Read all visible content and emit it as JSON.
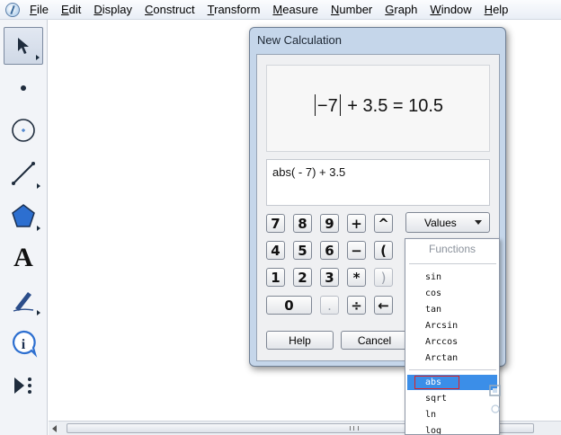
{
  "menubar": {
    "items": [
      {
        "label": "File",
        "accel": "F",
        "rest": "ile"
      },
      {
        "label": "Edit",
        "accel": "E",
        "rest": "dit"
      },
      {
        "label": "Display",
        "accel": "D",
        "rest": "isplay"
      },
      {
        "label": "Construct",
        "accel": "C",
        "rest": "onstruct"
      },
      {
        "label": "Transform",
        "accel": "T",
        "rest": "ransform"
      },
      {
        "label": "Measure",
        "accel": "M",
        "rest": "easure"
      },
      {
        "label": "Number",
        "accel": "N",
        "rest": "umber"
      },
      {
        "label": "Graph",
        "accel": "G",
        "rest": "raph"
      },
      {
        "label": "Window",
        "accel": "W",
        "rest": "indow"
      },
      {
        "label": "Help",
        "accel": "H",
        "rest": "elp"
      }
    ]
  },
  "toolbox": {
    "tools": [
      "arrow-select-tool",
      "point-tool",
      "compass-tool",
      "straightedge-tool",
      "polygon-tool",
      "text-tool",
      "marker-tool",
      "information-tool",
      "custom-tool"
    ],
    "text_tool_glyph": "A"
  },
  "dialog": {
    "title": "New Calculation",
    "display": {
      "abs_value": "−7",
      "rest": "+ 3.5 = 10.5"
    },
    "input_value": "abs( - 7) + 3.5",
    "keypad": {
      "row1": [
        "7",
        "8",
        "9",
        "+",
        "^"
      ],
      "row2": [
        "4",
        "5",
        "6",
        "−",
        "("
      ],
      "row3": [
        "1",
        "2",
        "3",
        "*",
        ")"
      ],
      "row4": [
        "0",
        ".",
        "÷",
        "←"
      ]
    },
    "values_button": "Values",
    "help_button": "Help",
    "cancel_button": "Cancel"
  },
  "functions_menu": {
    "header": "Functions",
    "items": [
      "sin",
      "cos",
      "tan",
      "Arcsin",
      "Arccos",
      "Arctan"
    ],
    "items2": [
      "abs",
      "sqrt",
      "ln",
      "log"
    ],
    "highlighted": "abs"
  },
  "colors": {
    "accent": "#3b8ee8",
    "dialog_frame": "#c5d6ea",
    "highlight_outline": "#e02020"
  }
}
